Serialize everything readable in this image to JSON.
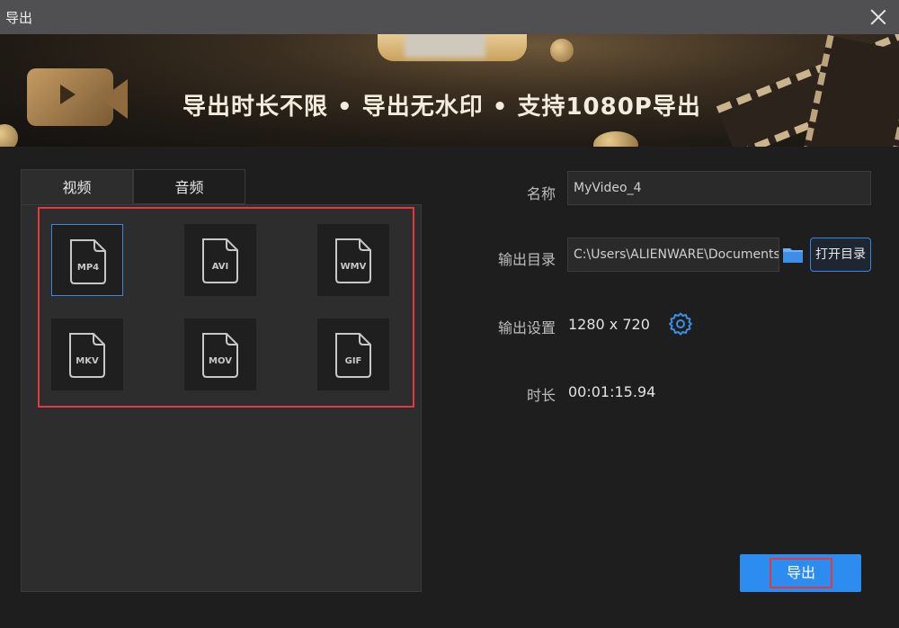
{
  "window": {
    "title": "导出"
  },
  "banner": {
    "slogan": "导出时长不限 • 导出无水印 • 支持1080P导出"
  },
  "tabs": [
    {
      "label": "视频"
    },
    {
      "label": "音频"
    }
  ],
  "formats": [
    {
      "label": "MP4",
      "selected": true
    },
    {
      "label": "AVI",
      "selected": false
    },
    {
      "label": "WMV",
      "selected": false
    },
    {
      "label": "MKV",
      "selected": false
    },
    {
      "label": "MOV",
      "selected": false
    },
    {
      "label": "GIF",
      "selected": false
    }
  ],
  "form": {
    "name_label": "名称",
    "name_value": "MyVideo_4",
    "dir_label": "输出目录",
    "dir_value": "C:\\Users\\ALIENWARE\\Documents\\",
    "open_dir_label": "打开目录",
    "settings_label": "输出设置",
    "settings_value": "1280 x 720",
    "duration_label": "时长",
    "duration_value": "00:01:15.94"
  },
  "export_button": {
    "label": "导出"
  },
  "colors": {
    "accent": "#2d8cf0",
    "highlight": "#e0393e",
    "background": "#1e1e1f"
  }
}
